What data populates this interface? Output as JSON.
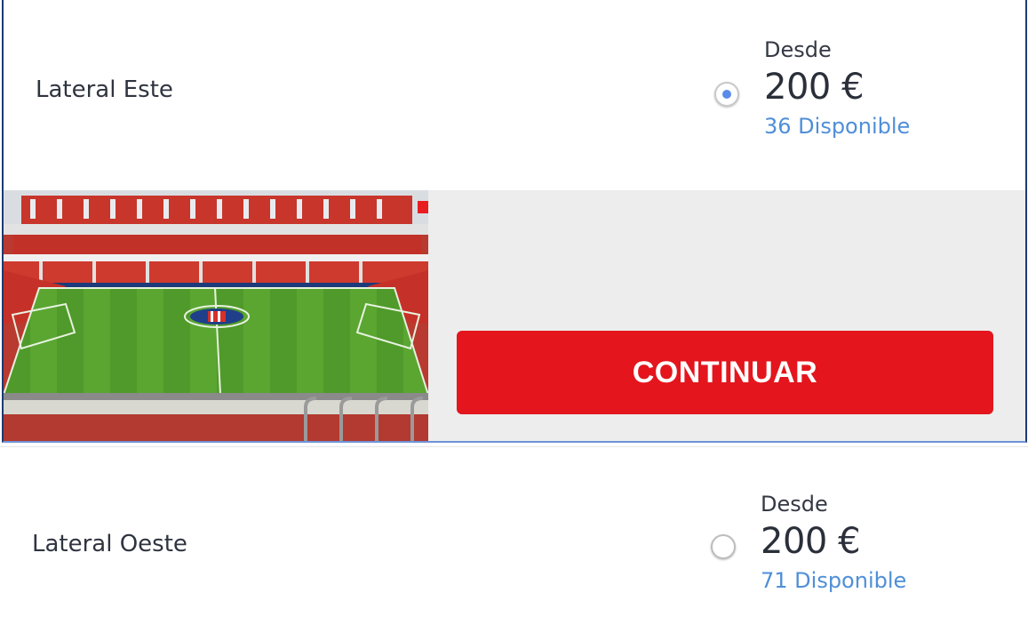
{
  "options": [
    {
      "zone": "Lateral Este",
      "from_label": "Desde",
      "price": "200 €",
      "availability": "36 Disponible",
      "selected": true
    },
    {
      "zone": "Lateral Oeste",
      "from_label": "Desde",
      "price": "200 €",
      "availability": "71 Disponible",
      "selected": false
    }
  ],
  "continue_label": "CONTINUAR",
  "colors": {
    "accent_red": "#e4151d",
    "availability_blue": "#4f8fd8",
    "radio_blue": "#5a8bea",
    "card_border": "#1e3a73"
  }
}
